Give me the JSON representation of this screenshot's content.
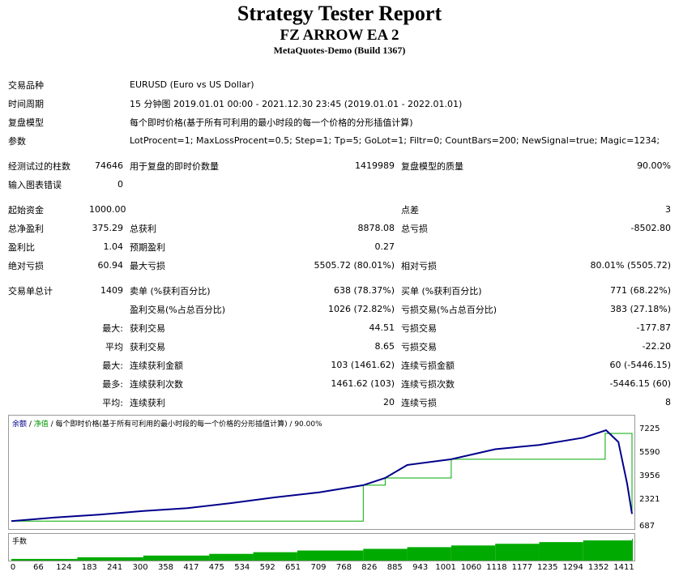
{
  "header": {
    "title": "Strategy Tester Report",
    "ea_name": "FZ ARROW EA 2",
    "server": "MetaQuotes-Demo (Build 1367)"
  },
  "info": {
    "symbol_label": "交易品种",
    "symbol_value": "EURUSD (Euro vs US Dollar)",
    "period_label": "时间周期",
    "period_value": "15 分钟图 2019.01.01 00:00 - 2021.12.30 23:45 (2019.01.01 - 2022.01.01)",
    "model_label": "复盘模型",
    "model_value": "每个即时价格(基于所有可利用的最小时段的每一个价格的分形插值计算)",
    "params_label": "参数",
    "params_value": "LotProcent=1; MaxLossProcent=0.5; Step=1; Tp=5; GoLot=1; Filtr=0; CountBars=200; NewSignal=true; Magic=1234;"
  },
  "test": {
    "bars_label": "经测试过的柱数",
    "bars_value": "74646",
    "ticks_label": "用于复盘的即时价数量",
    "ticks_value": "1419989",
    "quality_label": "复盘模型的质量",
    "quality_value": "90.00%",
    "errors_label": "输入图表错误",
    "errors_value": "0"
  },
  "stats": {
    "initial_deposit_label": "起始资金",
    "initial_deposit": "1000.00",
    "spread_label": "点差",
    "spread": "3",
    "net_profit_label": "总净盈利",
    "net_profit": "375.29",
    "gross_profit_label": "总获利",
    "gross_profit": "8878.08",
    "gross_loss_label": "总亏损",
    "gross_loss": "-8502.80",
    "profit_factor_label": "盈利比",
    "profit_factor": "1.04",
    "expected_payoff_label": "预期盈利",
    "expected_payoff": "0.27",
    "abs_dd_label": "绝对亏损",
    "abs_dd": "60.94",
    "max_dd_label": "最大亏损",
    "max_dd": "5505.72 (80.01%)",
    "rel_dd_label": "相对亏损",
    "rel_dd": "80.01% (5505.72)"
  },
  "trades": {
    "total_label": "交易单总计",
    "total": "1409",
    "short_label": "卖单 (%获利百分比)",
    "short": "638 (78.37%)",
    "long_label": "买单 (%获利百分比)",
    "long": "771 (68.22%)",
    "profit_trades_label": "盈利交易(%占总百分比)",
    "profit_trades": "1026 (72.82%)",
    "loss_trades_label": "亏损交易(%占总百分比)",
    "loss_trades": "383 (27.18%)",
    "largest_prefix": "最大:",
    "largest_profit_label": "获利交易",
    "largest_profit": "44.51",
    "largest_loss_label": "亏损交易",
    "largest_loss": "-177.87",
    "average_prefix": "平均",
    "avg_profit_label": "获利交易",
    "avg_profit": "8.65",
    "avg_loss_label": "亏损交易",
    "avg_loss": "-22.20",
    "max_prefix": "最大:",
    "max_consec_wins_label": "连续获利金额",
    "max_consec_wins": "103 (1461.62)",
    "max_consec_losses_label": "连续亏损金额",
    "max_consec_losses": "60 (-5446.15)",
    "most_prefix": "最多:",
    "max_consec_profit_label": "连续获利次数",
    "max_consec_profit": "1461.62 (103)",
    "max_consec_loss_label": "连续亏损次数",
    "max_consec_loss": "-5446.15 (60)",
    "avg2_prefix": "平均:",
    "avg_consec_wins_label": "连续获利",
    "avg_consec_wins": "20",
    "avg_consec_losses_label": "连续亏损",
    "avg_consec_losses": "8"
  },
  "chart": {
    "legend_balance": "余额",
    "legend_sep1": " / ",
    "legend_equity": "净值",
    "legend_rest": " / 每个即时价格(基于所有可利用的最小时段的每一个价格的分形插值计算) / 90.00%",
    "volume_label": "手数",
    "y_ticks": [
      "7225",
      "5590",
      "3956",
      "2321",
      "687"
    ],
    "x_ticks": [
      "0",
      "66",
      "124",
      "183",
      "241",
      "300",
      "358",
      "417",
      "475",
      "534",
      "592",
      "651",
      "709",
      "768",
      "826",
      "885",
      "943",
      "1001",
      "1060",
      "1118",
      "1177",
      "1235",
      "1294",
      "1352",
      "1411"
    ],
    "colors": {
      "balance": "#00008b",
      "equity": "#00aa00",
      "bars": "#00aa00"
    }
  },
  "chart_data": {
    "type": "line",
    "ylim": [
      687,
      7225
    ],
    "xlim": [
      0,
      1411
    ],
    "series": [
      {
        "name": "余额",
        "x": [
          0,
          100,
          200,
          300,
          400,
          500,
          600,
          700,
          800,
          850,
          900,
          1000,
          1100,
          1200,
          1300,
          1340,
          1352,
          1380,
          1400,
          1411
        ],
        "values": [
          900,
          1150,
          1350,
          1600,
          1800,
          2150,
          2550,
          2900,
          3400,
          3900,
          4800,
          5200,
          5900,
          6200,
          6700,
          7100,
          7225,
          6400,
          3500,
          1400
        ]
      },
      {
        "name": "净值",
        "x": [
          0,
          800,
          850,
          1000,
          1350,
          1355,
          1400,
          1411
        ],
        "values": [
          900,
          3400,
          3900,
          5200,
          7000,
          7000,
          7000,
          1400
        ]
      }
    ],
    "lots": {
      "x": [
        0,
        150,
        300,
        450,
        550,
        650,
        800,
        900,
        1000,
        1100,
        1200,
        1300,
        1411
      ],
      "values": [
        1,
        2,
        3,
        4,
        5,
        6,
        7,
        8,
        9,
        10,
        11,
        12,
        13
      ]
    }
  }
}
